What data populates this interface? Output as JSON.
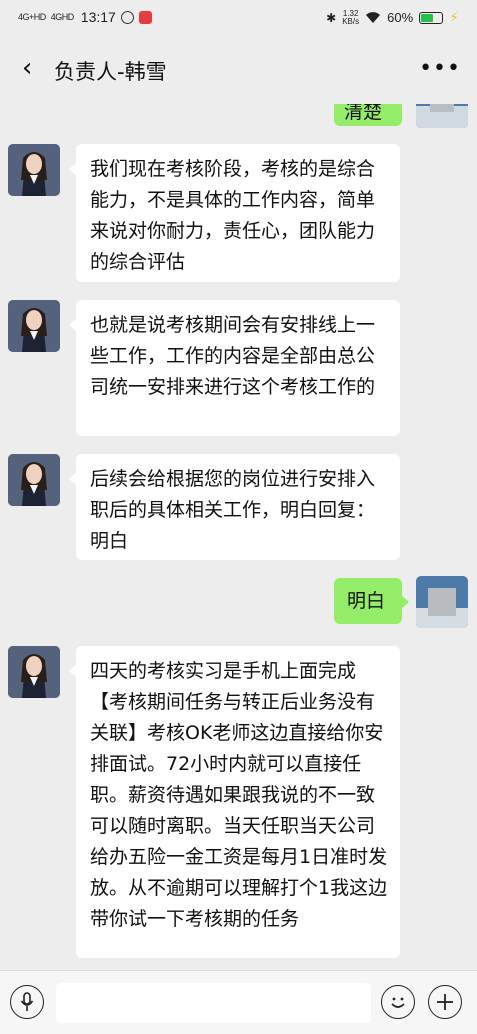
{
  "status_bar": {
    "signal_1": "4G+HD",
    "signal_2": "4GHD",
    "time": "13:17",
    "speed_value": "1.32",
    "speed_unit": "KB/s",
    "battery": "60%",
    "battery_level": 0.6
  },
  "header": {
    "back_icon": "‹",
    "title": "负责人-韩雪",
    "more_icon": "•••"
  },
  "messages": [
    {
      "side": "right",
      "text": "清楚",
      "partial": true
    },
    {
      "side": "left",
      "text": "我们现在考核阶段，考核的是综合能力，不是具体的工作内容，简单来说对你耐力，责任心，团队能力的综合评估"
    },
    {
      "side": "left",
      "text": "也就是说考核期间会有安排线上一些工作，工作的内容是全部由总公司统一安排来进行这个考核工作的"
    },
    {
      "side": "left",
      "text": "后续会给根据您的岗位进行安排入职后的具体相关工作，明白回复：明白"
    },
    {
      "side": "right",
      "text": "明白"
    },
    {
      "side": "left",
      "text": "四天的考核实习是手机上面完成【考核期间任务与转正后业务没有关联】考核OK老师这边直接给你安排面试。72小时内就可以直接任职。薪资待遇如果跟我说的不一致可以随时离职。当天任职当天公司给办五险一金工资是每月1日准时发放。从不逾期可以理解打个1我这边带你试一下考核期的任务"
    }
  ],
  "input_bar": {
    "voice_icon": "voice-icon",
    "input_value": "",
    "emoji_icon": "emoji-icon",
    "plus_icon": "plus-icon"
  },
  "colors": {
    "background": "#ededed",
    "bubble_self": "#95ec69",
    "bubble_other": "#ffffff",
    "battery": "#24c04a"
  }
}
